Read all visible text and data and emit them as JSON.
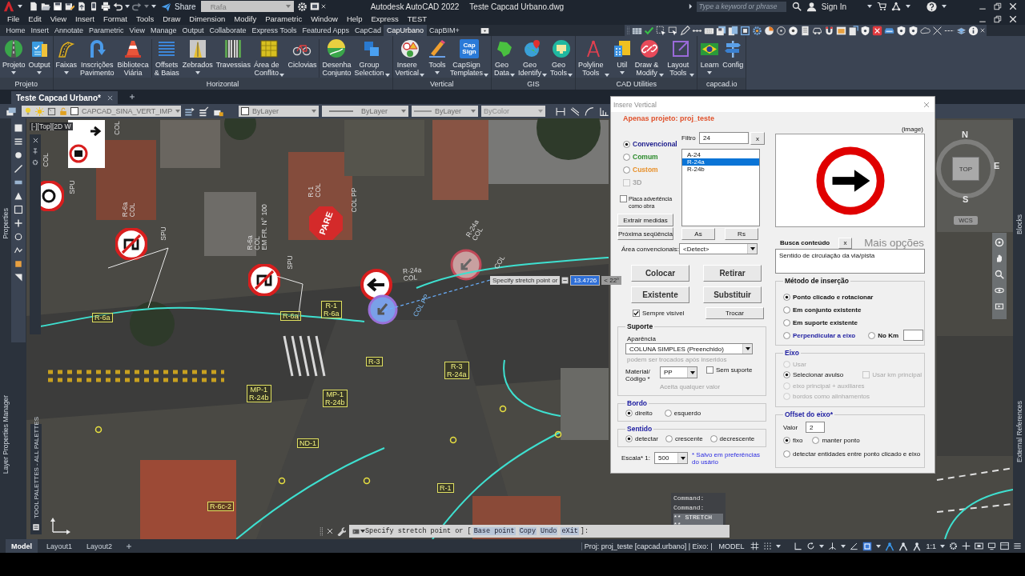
{
  "title_bar": {
    "share": "Share",
    "workspace": "Rafa",
    "app_title": "Autodesk AutoCAD 2022",
    "file_title": "Teste Capcad Urbano.dwg",
    "search": {
      "placeholder": "Type a keyword or phrase"
    },
    "sign_in": "Sign In"
  },
  "menu_bar": [
    "File",
    "Edit",
    "View",
    "Insert",
    "Format",
    "Tools",
    "Draw",
    "Dimension",
    "Modify",
    "Parametric",
    "Window",
    "Help",
    "Express",
    "TEST"
  ],
  "ribbon_tabs": [
    {
      "label": "Home",
      "selected": false
    },
    {
      "label": "Insert",
      "selected": false
    },
    {
      "label": "Annotate",
      "selected": false
    },
    {
      "label": "Parametric",
      "selected": false
    },
    {
      "label": "View",
      "selected": false
    },
    {
      "label": "Manage",
      "selected": false
    },
    {
      "label": "Output",
      "selected": false
    },
    {
      "label": "Collaborate",
      "selected": false
    },
    {
      "label": "Express Tools",
      "selected": false
    },
    {
      "label": "Featured Apps",
      "selected": false
    },
    {
      "label": "CapCad",
      "selected": false
    },
    {
      "label": "CapUrbano",
      "selected": true
    },
    {
      "label": "CapBIM+",
      "selected": false
    }
  ],
  "ribbon_panels": [
    {
      "title": "Projeto",
      "groups": [
        [
          {
            "label": "Projeto",
            "dropdown": true
          },
          {
            "label": "Output",
            "dropdown": true
          }
        ]
      ]
    },
    {
      "title": "Horizontal",
      "groups": [
        [
          {
            "label": "Faixas",
            "dropdown": true
          },
          {
            "label": "Inscrições\nPavimento",
            "dropdown": false
          },
          {
            "label": "Biblioteca\nViária",
            "dropdown": false
          }
        ],
        [
          {
            "label": "Offsets\n& Baias",
            "dropdown": false
          },
          {
            "label": "Zebrados",
            "dropdown": true
          },
          {
            "label": "Travessias",
            "dropdown": false
          },
          {
            "label": "Área de\nConflito",
            "dropdown": true
          },
          {
            "label": "Ciclovias",
            "dropdown": false
          }
        ],
        [
          {
            "label": "Desenha\nConjunto",
            "dropdown": false
          },
          {
            "label": "Group\nSelection",
            "dropdown": true
          }
        ]
      ]
    },
    {
      "title": "Vertical",
      "groups": [
        [
          {
            "label": "Insere\nVertical",
            "dropdown": true
          },
          {
            "label": "Tools",
            "dropdown": true
          },
          {
            "label": "CapSign\nTemplates",
            "dropdown": true,
            "logo_text": "Cap\nSign"
          }
        ]
      ]
    },
    {
      "title": "GIS",
      "groups": [
        [
          {
            "label": "Geo\nData",
            "dropdown": true
          },
          {
            "label": "Geo\nIdentify",
            "dropdown": true
          },
          {
            "label": "Geo\nTools",
            "dropdown": true
          }
        ]
      ]
    },
    {
      "title": "CAD Utilities",
      "groups": [
        [
          {
            "label": "Polyline\nTools",
            "dropdown": true
          },
          {
            "label": "Util",
            "dropdown": true
          },
          {
            "label": "Draw &\nModify",
            "dropdown": true
          },
          {
            "label": "Layout\nTools",
            "dropdown": true
          }
        ]
      ]
    },
    {
      "title": "capcad.io",
      "groups": [
        [
          {
            "label": "Learn",
            "dropdown": true
          },
          {
            "label": "Config",
            "dropdown": false
          }
        ]
      ]
    }
  ],
  "document_tabs": [
    {
      "label": "Teste Capcad Urbano*",
      "selected": true
    }
  ],
  "layer_bar": {
    "layer": "CAPCAD_SINA_VERT_IMP",
    "color_control": "ByLayer",
    "linetype": "ByLayer",
    "lineweight": "ByLayer",
    "plot_style": "ByColor"
  },
  "palettes": {
    "left": [
      "Properties",
      "Layer Properties Manager"
    ],
    "tool_palette": "TOOL PALETTES - ALL PALETTES",
    "right": [
      "Blocks",
      "External References"
    ]
  },
  "viewport": {
    "label": "[-][Top][2D W",
    "stop_sign": "PARE",
    "labels": [
      "R-6a",
      "R-6a",
      "R-1\nR-6a",
      "R-3",
      "R-3\nR-24a",
      "MP-1\nR-24b",
      "MP-1\nR-24b",
      "ND-1",
      "R-1",
      "R-6c-2"
    ],
    "texts": [
      "COL",
      "COL",
      "SPU",
      "R-6a\nCOL",
      "SPU",
      "R-6a\nCOL\nEM FR. N° 100",
      "SPU",
      "R-1\nCOL",
      "COL PP",
      "R-24a\nCOL",
      "R-24a\nCOL",
      "COL PP",
      "COL"
    ],
    "tooltip": {
      "prompt": "Specify stretch point or",
      "distance": "13.4726",
      "angle": "< 22°"
    },
    "view_cube": {
      "north": "N",
      "east": "E",
      "south": "S",
      "face": "TOP",
      "ucs": "WCS"
    }
  },
  "command_line": {
    "history": [
      "Command:",
      "Command:",
      "** STRETCH **"
    ],
    "prompt": "Specify stretch point or [",
    "options": [
      "Base point",
      "Copy",
      "Undo",
      "eXit"
    ],
    "suffix": "]:"
  },
  "dialog": {
    "title": "Insere Vertical",
    "scope": "Apenas projeto: proj_teste",
    "catalogs": [
      {
        "label": "Convencional",
        "selected": true,
        "color": "#1c1c8c"
      },
      {
        "label": "Comum",
        "selected": false,
        "color": "#2a8a2a"
      },
      {
        "label": "Custom",
        "selected": false,
        "color": "#e8902a"
      }
    ],
    "three_d": {
      "label": "3D",
      "checked": false,
      "disabled": true
    },
    "filter": {
      "label": "Filtro",
      "value": "24",
      "clear": "x"
    },
    "sign_list": [
      {
        "label": "A-24",
        "selected": false
      },
      {
        "label": "R-24a",
        "selected": true
      },
      {
        "label": "R-24b",
        "selected": false
      }
    ],
    "warning_as_work": {
      "label": "Placa advertência\ncomo obra",
      "checked": false
    },
    "tool_buttons": [
      "Extrair medidas",
      "Próxima seqüência",
      "As",
      "Rs"
    ],
    "area": {
      "label": "Área convencionais:",
      "value": "<Detect>"
    },
    "actions": [
      "Colocar",
      "Retirar",
      "Existente",
      "Substituir"
    ],
    "always_visible": {
      "label": "Sempre visível",
      "checked": true
    },
    "swap": "Trocar",
    "support": {
      "title": "Suporte",
      "appearance_label": "Aparência",
      "appearance": "COLUNA SIMPLES (Preenchido)",
      "appearance_hint": "podem ser trocados após inseridos",
      "material_label": "Material/\nCódigo *",
      "material": "PP",
      "no_support": {
        "label": "Sem suporte",
        "checked": false
      },
      "material_hint": "Aceita qualquer valor"
    },
    "edge": {
      "title": "Bordo",
      "options": [
        {
          "label": "direito",
          "selected": true
        },
        {
          "label": "esquerdo",
          "selected": false
        }
      ]
    },
    "direction": {
      "title": "Sentido",
      "options": [
        {
          "label": "detectar",
          "selected": true
        },
        {
          "label": "crescente",
          "selected": false
        },
        {
          "label": "decrescente",
          "selected": false
        }
      ]
    },
    "scale": {
      "label": "Escala* 1:",
      "value": "500",
      "note": "* Salvo em preferências do usário"
    },
    "image_label": "(image)",
    "search": {
      "label": "Busca conteúdo",
      "clear": "x",
      "more": "Mais opções",
      "value": "Sentido de circulação da via/pista"
    },
    "method": {
      "title": "Método de inserção",
      "options": [
        {
          "label": "Ponto clicado e rotacionar",
          "selected": true,
          "color": "#111111"
        },
        {
          "label": "Em conjunto existente",
          "selected": false,
          "color": "#111111"
        },
        {
          "label": "Em suporte existente",
          "selected": false,
          "color": "#111111"
        },
        {
          "label": "Perpendicular a eixo",
          "selected": false,
          "color": "#1c1ca0"
        },
        {
          "label": "No Km",
          "selected": false,
          "color": "#111111"
        }
      ]
    },
    "axis": {
      "title": "Eixo",
      "options": [
        {
          "label": "Usar",
          "selected": false,
          "disabled": true
        },
        {
          "label": "Selecionar avulso",
          "selected": true,
          "disabled": false
        },
        {
          "label": "eixo principal + auxiliares",
          "selected": false,
          "disabled": true
        },
        {
          "label": "bordos como alinhamentos",
          "selected": false,
          "disabled": true
        }
      ],
      "km_main": {
        "label": "Usar km principal",
        "checked": false,
        "disabled": true
      }
    },
    "offset": {
      "title": "Offset do eixo*",
      "value_label": "Valor",
      "value": "2",
      "options": [
        {
          "label": "fixo",
          "selected": true
        },
        {
          "label": "manter ponto",
          "selected": false
        },
        {
          "label": "detectar entidades entre ponto clicado e eixo",
          "selected": false
        }
      ]
    }
  },
  "status_bar": {
    "layout_tabs": [
      {
        "label": "Model",
        "selected": true
      },
      {
        "label": "Layout1",
        "selected": false
      },
      {
        "label": "Layout2",
        "selected": false
      }
    ],
    "project": "Proj: proj_teste [capcad.urbano] | Eixo: |",
    "space": "MODEL",
    "scale": "1:1"
  }
}
